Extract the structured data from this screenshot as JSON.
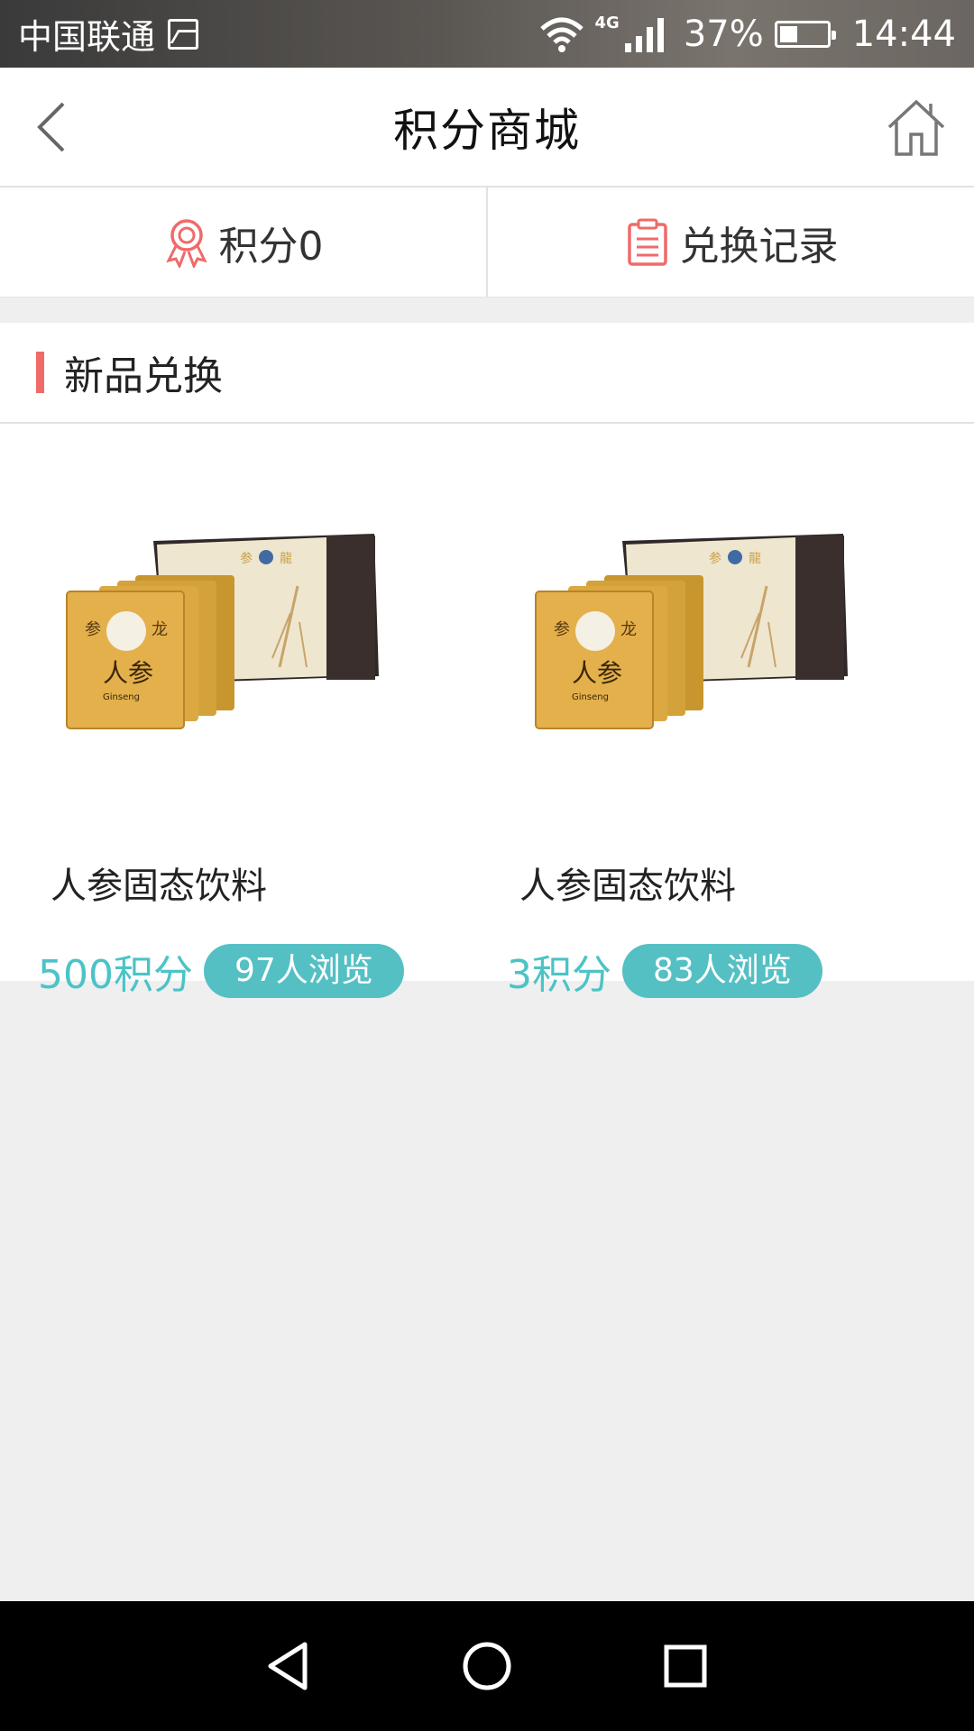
{
  "status_bar": {
    "carrier": "中国联通",
    "network": "4G",
    "battery": "37%",
    "battery_level": 0.37,
    "time": "14:44",
    "icons": [
      "image-icon",
      "wifi-icon",
      "signal-icon",
      "battery-icon"
    ]
  },
  "header": {
    "title": "积分商城",
    "back_icon": "chevron-left-icon",
    "home_icon": "home-icon"
  },
  "actions": {
    "points_label": "积分0",
    "points_icon": "medal-icon",
    "records_label": "兑换记录",
    "records_icon": "clipboard-icon"
  },
  "section": {
    "title": "新品兑换",
    "accent_color": "#f06a6a"
  },
  "products": [
    {
      "name": "人参固态饮料",
      "price": "500积分",
      "views": "97人浏览"
    },
    {
      "name": "人参固态饮料",
      "price": "3积分",
      "views": "83人浏览"
    }
  ],
  "colors": {
    "teal": "#54c0c4",
    "price_teal": "#4cc3c6",
    "background": "#efefef"
  },
  "nav": {
    "icons": [
      "back-triangle-icon",
      "home-circle-icon",
      "recents-square-icon"
    ]
  }
}
